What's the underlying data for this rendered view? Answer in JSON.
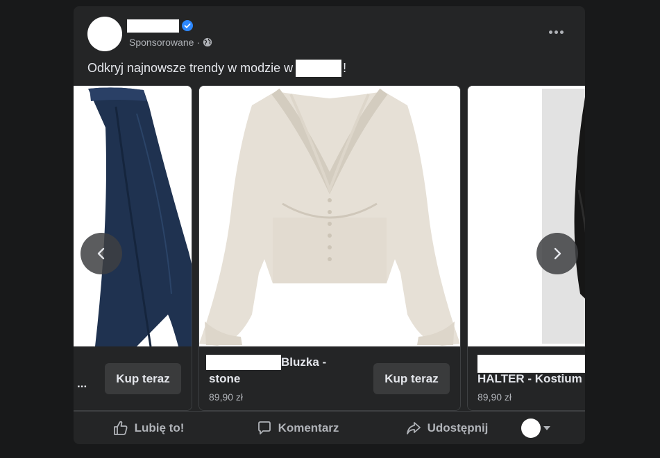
{
  "post": {
    "sponsored_label": "Sponsorowane",
    "dot": "·",
    "text_before": "Odkryj najnowsze trendy w modzie w",
    "text_after": "!"
  },
  "carousel": {
    "cards": [
      {
        "title": "...",
        "cta": "Kup teraz"
      },
      {
        "title_suffix": "Bluzka -",
        "title_line2": "stone",
        "price": "89,90 zł",
        "cta": "Kup teraz"
      },
      {
        "title": "HALTER - Kostium",
        "price": "89,90 zł"
      }
    ]
  },
  "actions": {
    "like": "Lubię to!",
    "comment": "Komentarz",
    "share": "Udostępnij"
  },
  "icons": {
    "verified": "verified-badge-icon",
    "globe": "globe-icon",
    "more": "more-options-icon",
    "prev": "chevron-left-icon",
    "next": "chevron-right-icon",
    "like": "thumbs-up-icon",
    "comment": "comment-icon",
    "share": "share-icon"
  },
  "colors": {
    "background": "#18191a",
    "card": "#242526",
    "text_primary": "#e4e6eb",
    "text_secondary": "#b0b3b8",
    "verified_blue": "#2d88ff",
    "button": "#3a3b3c"
  }
}
